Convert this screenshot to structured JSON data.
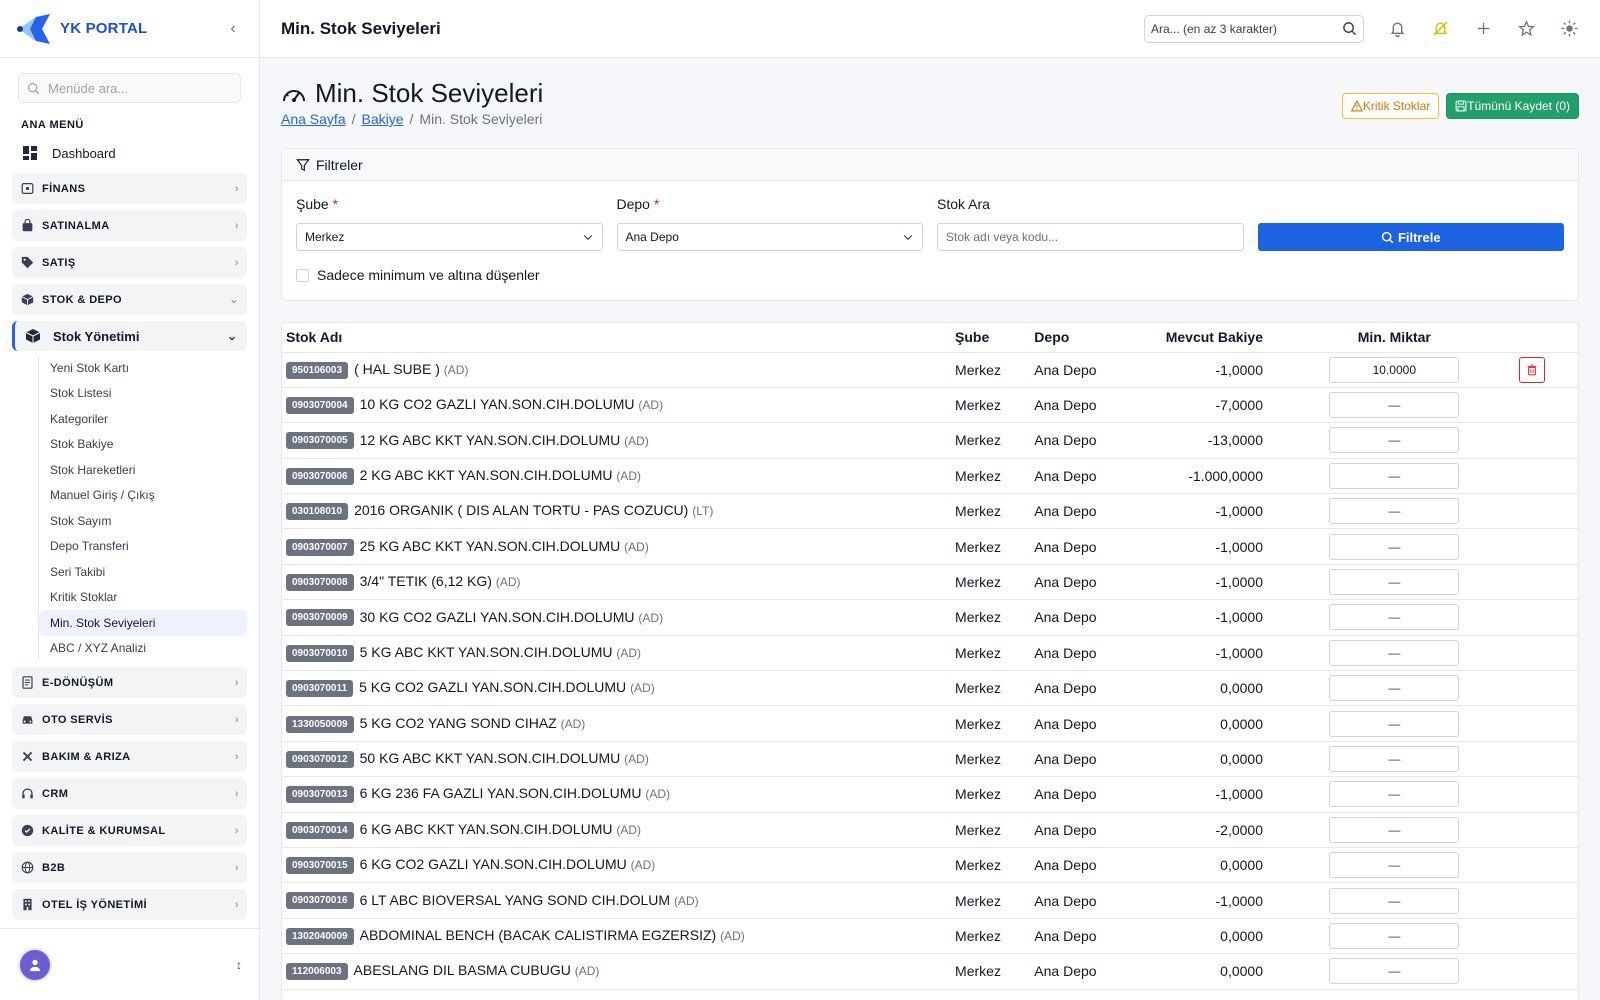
{
  "brand": {
    "name": "YK PORTAL"
  },
  "sidebar": {
    "search_placeholder": "Menüde ara...",
    "menu_title": "ANA MENÜ",
    "dashboard": "Dashboard",
    "groups_top": [
      {
        "label": "FİNANS",
        "icon": "finance-icon"
      },
      {
        "label": "SATINALMA",
        "icon": "bag-icon"
      },
      {
        "label": "SATIŞ",
        "icon": "tag-icon"
      },
      {
        "label": "STOK & DEPO",
        "icon": "box-icon"
      }
    ],
    "subgroup": "Stok Yönetimi",
    "subitems": [
      "Yeni Stok Kartı",
      "Stok Listesi",
      "Kategoriler",
      "Stok Bakiye",
      "Stok Hareketleri",
      "Manuel Giriş / Çıkış",
      "Stok Sayım",
      "Depo Transferi",
      "Seri Takibi",
      "Kritik Stoklar",
      "Min. Stok Seviyeleri",
      "ABC / XYZ Analizi"
    ],
    "active_subitem": "Min. Stok Seviyeleri",
    "groups_bottom": [
      {
        "label": "E-DÖNÜŞÜM",
        "icon": "document-icon"
      },
      {
        "label": "OTO SERVİS",
        "icon": "car-icon"
      },
      {
        "label": "BAKIM & ARIZA",
        "icon": "wrench-icon"
      },
      {
        "label": "CRM",
        "icon": "headset-icon"
      },
      {
        "label": "KALİTE & KURUMSAL",
        "icon": "badge-icon"
      },
      {
        "label": "B2B",
        "icon": "globe-icon"
      },
      {
        "label": "OTEL İŞ YÖNETİMİ",
        "icon": "building-icon"
      }
    ]
  },
  "topbar": {
    "title": "Min. Stok Seviyeleri",
    "search_placeholder": "Ara... (en az 3 karakter)"
  },
  "page": {
    "title": "Min. Stok Seviyeleri",
    "breadcrumb": [
      "Ana Sayfa",
      "Bakiye",
      "Min. Stok Seviyeleri"
    ],
    "btn_critical": "Kritik Stoklar",
    "btn_save_all": "Tümünü Kaydet (0)"
  },
  "filters": {
    "title": "Filtreler",
    "branch_label": "Şube",
    "branch_value": "Merkez",
    "warehouse_label": "Depo",
    "warehouse_value": "Ana Depo",
    "stock_search_label": "Stok Ara",
    "stock_search_placeholder": "Stok adı veya kodu...",
    "filter_button": "Filtrele",
    "only_below_min": "Sadece minimum ve altına düşenler"
  },
  "table": {
    "headers": {
      "name": "Stok Adı",
      "branch": "Şube",
      "warehouse": "Depo",
      "balance": "Mevcut Bakiye",
      "min": "Min. Miktar"
    },
    "empty_min": "—",
    "rows": [
      {
        "code": "950106003",
        "name": "( HAL SUBE )",
        "unit": "(AD)",
        "branch": "Merkez",
        "warehouse": "Ana Depo",
        "balance": "-1,0000",
        "min": "10.0000"
      },
      {
        "code": "0903070004",
        "name": "10 KG CO2 GAZLI YAN.SON.CIH.DOLUMU",
        "unit": "(AD)",
        "branch": "Merkez",
        "warehouse": "Ana Depo",
        "balance": "-7,0000",
        "min": ""
      },
      {
        "code": "0903070005",
        "name": "12 KG ABC KKT YAN.SON.CIH.DOLUMU",
        "unit": "(AD)",
        "branch": "Merkez",
        "warehouse": "Ana Depo",
        "balance": "-13,0000",
        "min": ""
      },
      {
        "code": "0903070006",
        "name": "2 KG ABC KKT YAN.SON.CIH.DOLUMU",
        "unit": "(AD)",
        "branch": "Merkez",
        "warehouse": "Ana Depo",
        "balance": "-1.000,0000",
        "min": ""
      },
      {
        "code": "030108010",
        "name": "2016 ORGANIK ( DIS ALAN TORTU - PAS COZUCU)",
        "unit": "(LT)",
        "branch": "Merkez",
        "warehouse": "Ana Depo",
        "balance": "-1,0000",
        "min": ""
      },
      {
        "code": "0903070007",
        "name": "25 KG ABC KKT YAN.SON.CIH.DOLUMU",
        "unit": "(AD)",
        "branch": "Merkez",
        "warehouse": "Ana Depo",
        "balance": "-1,0000",
        "min": ""
      },
      {
        "code": "0903070008",
        "name": "3/4\" TETIK (6,12 KG)",
        "unit": "(AD)",
        "branch": "Merkez",
        "warehouse": "Ana Depo",
        "balance": "-1,0000",
        "min": ""
      },
      {
        "code": "0903070009",
        "name": "30 KG CO2 GAZLI YAN.SON.CIH.DOLUMU",
        "unit": "(AD)",
        "branch": "Merkez",
        "warehouse": "Ana Depo",
        "balance": "-1,0000",
        "min": ""
      },
      {
        "code": "0903070010",
        "name": "5 KG ABC KKT YAN.SON.CIH.DOLUMU",
        "unit": "(AD)",
        "branch": "Merkez",
        "warehouse": "Ana Depo",
        "balance": "-1,0000",
        "min": ""
      },
      {
        "code": "0903070011",
        "name": "5 KG CO2 GAZLI YAN.SON.CIH.DOLUMU",
        "unit": "(AD)",
        "branch": "Merkez",
        "warehouse": "Ana Depo",
        "balance": "0,0000",
        "min": ""
      },
      {
        "code": "1330050009",
        "name": "5 KG CO2 YANG SOND CIHAZ",
        "unit": "(AD)",
        "branch": "Merkez",
        "warehouse": "Ana Depo",
        "balance": "0,0000",
        "min": ""
      },
      {
        "code": "0903070012",
        "name": "50 KG ABC KKT YAN.SON.CIH.DOLUMU",
        "unit": "(AD)",
        "branch": "Merkez",
        "warehouse": "Ana Depo",
        "balance": "0,0000",
        "min": ""
      },
      {
        "code": "0903070013",
        "name": "6 KG 236 FA GAZLI YAN.SON.CIH.DOLUMU",
        "unit": "(AD)",
        "branch": "Merkez",
        "warehouse": "Ana Depo",
        "balance": "-1,0000",
        "min": ""
      },
      {
        "code": "0903070014",
        "name": "6 KG ABC KKT YAN.SON.CIH.DOLUMU",
        "unit": "(AD)",
        "branch": "Merkez",
        "warehouse": "Ana Depo",
        "balance": "-2,0000",
        "min": ""
      },
      {
        "code": "0903070015",
        "name": "6 KG CO2 GAZLI YAN.SON.CIH.DOLUMU",
        "unit": "(AD)",
        "branch": "Merkez",
        "warehouse": "Ana Depo",
        "balance": "0,0000",
        "min": ""
      },
      {
        "code": "0903070016",
        "name": "6 LT ABC BIOVERSAL YANG SOND CIH.DOLUM",
        "unit": "(AD)",
        "branch": "Merkez",
        "warehouse": "Ana Depo",
        "balance": "-1,0000",
        "min": ""
      },
      {
        "code": "1302040009",
        "name": "ABDOMINAL BENCH (BACAK CALISTIRMA EGZERSIZ)",
        "unit": "(AD)",
        "branch": "Merkez",
        "warehouse": "Ana Depo",
        "balance": "0,0000",
        "min": ""
      },
      {
        "code": "112006003",
        "name": "ABESLANG DIL BASMA CUBUGU",
        "unit": "(AD)",
        "branch": "Merkez",
        "warehouse": "Ana Depo",
        "balance": "0,0000",
        "min": ""
      }
    ]
  },
  "colors": {
    "primary": "#1d62e0",
    "success": "#22a06b",
    "warning": "#d97706",
    "danger": "#dc2626"
  }
}
